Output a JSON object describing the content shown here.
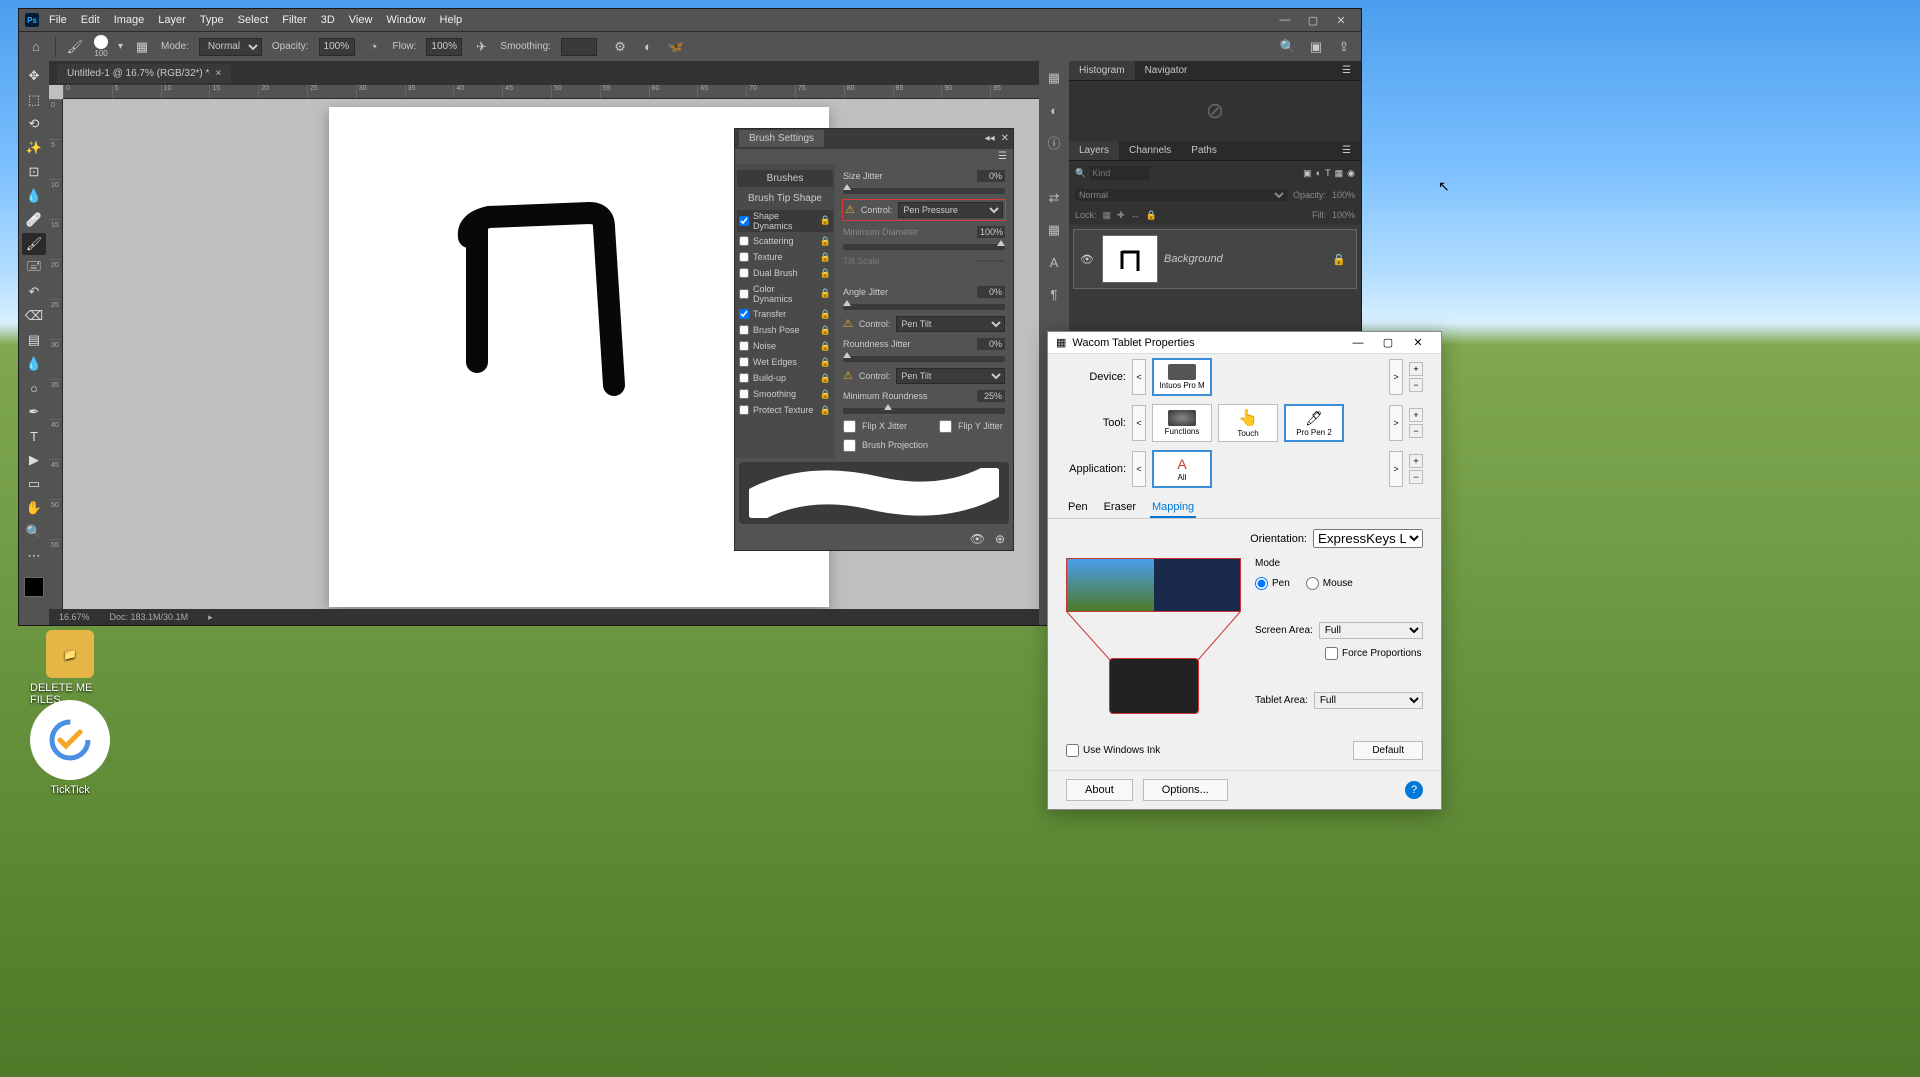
{
  "desktop": {
    "icon1": "DELETE ME FILES",
    "icon2": "TickTick"
  },
  "ps": {
    "menu": [
      "File",
      "Edit",
      "Image",
      "Layer",
      "Type",
      "Select",
      "Filter",
      "3D",
      "View",
      "Window",
      "Help"
    ],
    "optbar": {
      "mode_lbl": "Mode:",
      "mode": "Normal",
      "opacity_lbl": "Opacity:",
      "opacity": "100%",
      "flow_lbl": "Flow:",
      "flow": "100%",
      "smoothing_lbl": "Smoothing:",
      "smoothing": "",
      "brush_size": "100"
    },
    "tab": "Untitled-1 @ 16.7% (RGB/32*) *",
    "ruler_h": [
      "0",
      "5",
      "10",
      "15",
      "20",
      "25",
      "30",
      "35",
      "40",
      "45",
      "50",
      "55",
      "60",
      "65",
      "70",
      "75",
      "80",
      "85",
      "90",
      "95"
    ],
    "ruler_v": [
      "0",
      "5",
      "10",
      "15",
      "20",
      "25",
      "30",
      "35",
      "40",
      "45",
      "50",
      "55"
    ],
    "status_zoom": "16.67%",
    "status_doc": "Doc: 183.1M/30.1M",
    "panels": {
      "histogram": "Histogram",
      "navigator": "Navigator",
      "layers": "Layers",
      "channels": "Channels",
      "paths": "Paths"
    },
    "layers": {
      "search_ph": "Kind",
      "blend": "Normal",
      "opacity_lbl": "Opacity:",
      "opacity": "100%",
      "lock_lbl": "Lock:",
      "fill_lbl": "Fill:",
      "fill": "100%",
      "layer_name": "Background"
    }
  },
  "brush": {
    "title": "Brush Settings",
    "brushes_btn": "Brushes",
    "tip": "Brush Tip Shape",
    "items": [
      {
        "label": "Shape Dynamics",
        "checked": true,
        "hl": true
      },
      {
        "label": "Scattering",
        "checked": false
      },
      {
        "label": "Texture",
        "checked": false
      },
      {
        "label": "Dual Brush",
        "checked": false
      },
      {
        "label": "Color Dynamics",
        "checked": false
      },
      {
        "label": "Transfer",
        "checked": true
      },
      {
        "label": "Brush Pose",
        "checked": false
      },
      {
        "label": "Noise",
        "checked": false
      },
      {
        "label": "Wet Edges",
        "checked": false
      },
      {
        "label": "Build-up",
        "checked": false
      },
      {
        "label": "Smoothing",
        "checked": false
      },
      {
        "label": "Protect Texture",
        "checked": false
      }
    ],
    "size_jitter": "Size Jitter",
    "size_jitter_v": "0%",
    "control": "Control:",
    "pen_pressure": "Pen Pressure",
    "min_diam": "Minimum Diameter",
    "min_diam_v": "100%",
    "tilt_scale": "Tilt Scale",
    "angle_jitter": "Angle Jitter",
    "angle_jitter_v": "0%",
    "pen_tilt": "Pen Tilt",
    "round_jitter": "Roundness Jitter",
    "round_jitter_v": "0%",
    "min_round": "Minimum Roundness",
    "min_round_v": "25%",
    "flip_x": "Flip X Jitter",
    "flip_y": "Flip Y Jitter",
    "brush_proj": "Brush Projection"
  },
  "wacom": {
    "title": "Wacom Tablet Properties",
    "device_lbl": "Device:",
    "device": "Intuos Pro M",
    "tool_lbl": "Tool:",
    "tools": [
      "Functions",
      "Touch",
      "Pro Pen 2"
    ],
    "app_lbl": "Application:",
    "app": "All",
    "tabs": [
      "Pen",
      "Eraser",
      "Mapping"
    ],
    "orientation_lbl": "Orientation:",
    "orientation": "ExpressKeys Left",
    "mode_lbl": "Mode",
    "mode_pen": "Pen",
    "mode_mouse": "Mouse",
    "screen_area_lbl": "Screen Area:",
    "screen_area": "Full",
    "force_prop": "Force Proportions",
    "tablet_area_lbl": "Tablet Area:",
    "tablet_area": "Full",
    "use_ink": "Use Windows Ink",
    "default_btn": "Default",
    "about": "About",
    "options": "Options..."
  }
}
